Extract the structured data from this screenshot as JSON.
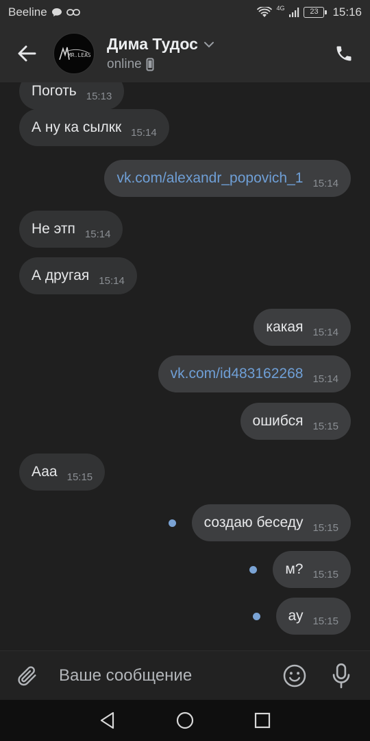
{
  "status_bar": {
    "carrier": "Beeline",
    "network": "4G",
    "battery": "23",
    "time": "15:16"
  },
  "header": {
    "contact_name": "Дима Тудос",
    "contact_status": "online",
    "avatar_text": "MR.LEAS"
  },
  "messages": [
    {
      "text": "Поготь",
      "time": "15:13",
      "direction": "in",
      "link": false
    },
    {
      "text": "А ну ка сылкк",
      "time": "15:14",
      "direction": "in",
      "link": false
    },
    {
      "text": "vk.com/alexandr_popovich_1",
      "time": "15:14",
      "direction": "out",
      "link": true
    },
    {
      "text": "Не этп",
      "time": "15:14",
      "direction": "in",
      "link": false
    },
    {
      "text": "А другая",
      "time": "15:14",
      "direction": "in",
      "link": false
    },
    {
      "text": "какая",
      "time": "15:14",
      "direction": "out",
      "link": false
    },
    {
      "text": "vk.com/id483162268",
      "time": "15:14",
      "direction": "out",
      "link": true
    },
    {
      "text": "ошибся",
      "time": "15:15",
      "direction": "out",
      "link": false
    },
    {
      "text": "Ааа",
      "time": "15:15",
      "direction": "in",
      "link": false
    },
    {
      "text": "создаю беседу",
      "time": "15:15",
      "direction": "out",
      "link": false,
      "unread": true
    },
    {
      "text": "м?",
      "time": "15:15",
      "direction": "out",
      "link": false,
      "unread": true
    },
    {
      "text": "ау",
      "time": "15:15",
      "direction": "out",
      "link": false,
      "unread": true
    }
  ],
  "composer": {
    "placeholder": "Ваше сообщение"
  },
  "colors": {
    "link": "#6f9fd6",
    "unread_dot": "#7aa3d4",
    "header_bg": "#2b2b2b",
    "chat_bg": "#1f1f1f"
  }
}
